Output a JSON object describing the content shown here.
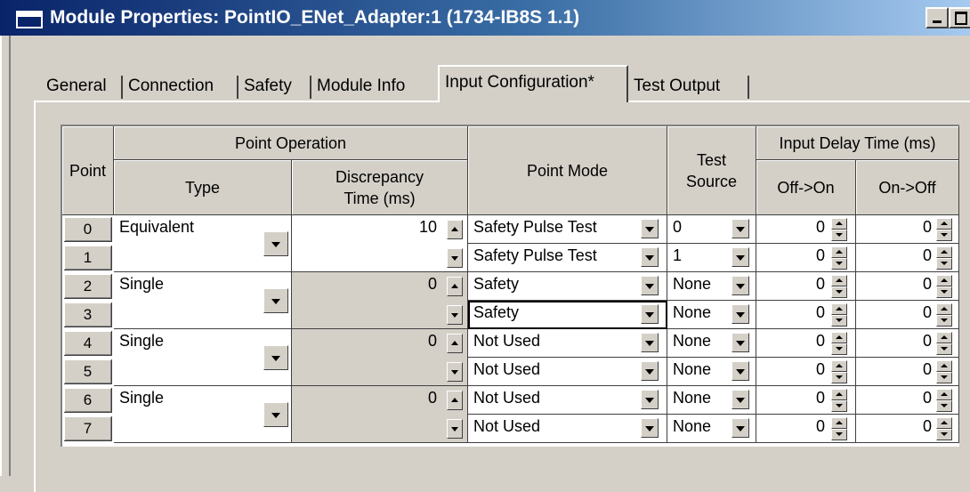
{
  "window": {
    "title": "Module Properties: PointIO_ENet_Adapter:1 (1734-IB8S 1.1)",
    "icons": [
      "app-window-icon",
      "minimize-icon",
      "maximize-icon"
    ]
  },
  "tabs": [
    {
      "label": "General",
      "active": false
    },
    {
      "label": "Connection",
      "active": false
    },
    {
      "label": "Safety",
      "active": false
    },
    {
      "label": "Module Info",
      "active": false
    },
    {
      "label": "Input Configuration*",
      "active": true
    },
    {
      "label": "Test Output",
      "active": false
    }
  ],
  "grid": {
    "headers": {
      "point": "Point",
      "point_operation": "Point Operation",
      "type": "Type",
      "discrepancy": "Discrepancy\nTime (ms)",
      "point_mode": "Point Mode",
      "test_source": "Test\nSource",
      "input_delay": "Input Delay Time (ms)",
      "off_on": "Off->On",
      "on_off": "On->Off"
    },
    "pairs": [
      {
        "type": "Equivalent",
        "discrepancy": "10"
      },
      {
        "type": "Single",
        "discrepancy": "0"
      },
      {
        "type": "Single",
        "discrepancy": "0"
      },
      {
        "type": "Single",
        "discrepancy": "0"
      }
    ],
    "rows": [
      {
        "point": "0",
        "mode": "Safety Pulse Test",
        "test_source": "0",
        "off_on": "0",
        "on_off": "0"
      },
      {
        "point": "1",
        "mode": "Safety Pulse Test",
        "test_source": "1",
        "off_on": "0",
        "on_off": "0"
      },
      {
        "point": "2",
        "mode": "Safety",
        "test_source": "None",
        "off_on": "0",
        "on_off": "0"
      },
      {
        "point": "3",
        "mode": "Safety",
        "test_source": "None",
        "off_on": "0",
        "on_off": "0"
      },
      {
        "point": "4",
        "mode": "Not Used",
        "test_source": "None",
        "off_on": "0",
        "on_off": "0"
      },
      {
        "point": "5",
        "mode": "Not Used",
        "test_source": "None",
        "off_on": "0",
        "on_off": "0"
      },
      {
        "point": "6",
        "mode": "Not Used",
        "test_source": "None",
        "off_on": "0",
        "on_off": "0"
      },
      {
        "point": "7",
        "mode": "Not Used",
        "test_source": "None",
        "off_on": "0",
        "on_off": "0"
      }
    ],
    "focused_row": 3
  }
}
